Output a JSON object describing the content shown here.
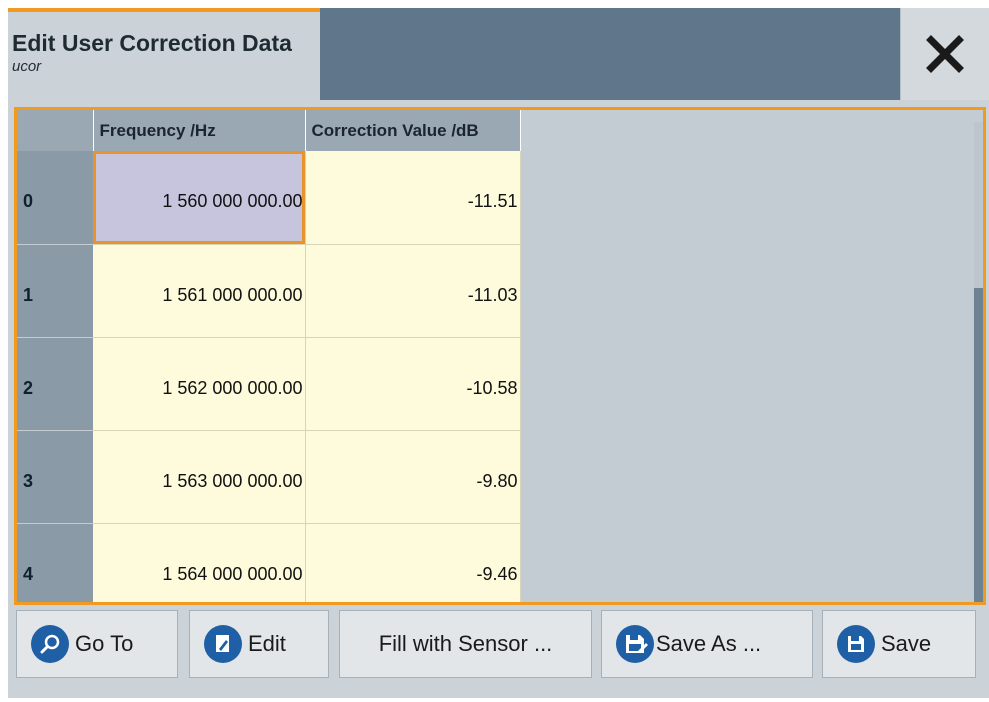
{
  "header": {
    "title": "Edit User Correction Data",
    "subtitle": "ucor",
    "close_icon": "close-icon"
  },
  "table": {
    "columns": [
      "",
      "Frequency /Hz",
      "Correction Value /dB"
    ],
    "rows": [
      {
        "index": "0",
        "frequency": "1 560 000 000.00",
        "correction": "-11.51"
      },
      {
        "index": "1",
        "frequency": "1 561 000 000.00",
        "correction": "-11.03"
      },
      {
        "index": "2",
        "frequency": "1 562 000 000.00",
        "correction": "-10.58"
      },
      {
        "index": "3",
        "frequency": "1 563 000 000.00",
        "correction": "-9.80"
      },
      {
        "index": "4",
        "frequency": "1 564 000 000.00",
        "correction": "-9.46"
      }
    ]
  },
  "buttons": {
    "goto": "Go To",
    "edit": "Edit",
    "fill": "Fill with Sensor ...",
    "save_as": "Save As ...",
    "save": "Save"
  },
  "colors": {
    "accent": "#f29a1f",
    "header_bar": "#60768a",
    "cell_bg": "#fdfbdb",
    "selected_cell": "#c7c5de",
    "icon_blue": "#1f5fa5"
  }
}
